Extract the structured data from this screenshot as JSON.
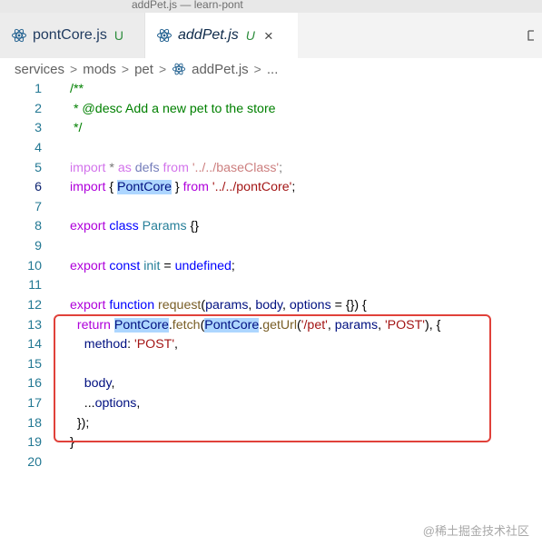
{
  "window": {
    "title": "addPet.js — learn-pont"
  },
  "tabs": [
    {
      "label": "pontCore.js",
      "status": "U",
      "active": false
    },
    {
      "label": "addPet.js",
      "status": "U",
      "active": true,
      "close": "×"
    }
  ],
  "icons": {
    "file_icon": "react-atom-icon",
    "split_editor": "split-editor-icon",
    "tab_close": "close-icon"
  },
  "breadcrumb": {
    "segments": [
      "services",
      "mods",
      "pet",
      "addPet.js",
      "..."
    ],
    "separator": ">"
  },
  "editor": {
    "active_line": 6,
    "lines": [
      {
        "n": "1",
        "tokens": [
          {
            "t": "/**",
            "c": "comment"
          }
        ]
      },
      {
        "n": "2",
        "tokens": [
          {
            "t": " * @desc Add a new pet to the store",
            "c": "comment"
          }
        ]
      },
      {
        "n": "3",
        "tokens": [
          {
            "t": " */",
            "c": "comment"
          }
        ]
      },
      {
        "n": "4",
        "tokens": []
      },
      {
        "n": "5",
        "tokens": [
          {
            "t": "import",
            "c": "kw faded"
          },
          {
            "t": " * ",
            "c": "plain faded"
          },
          {
            "t": "as",
            "c": "kw faded"
          },
          {
            "t": " defs ",
            "c": "var faded"
          },
          {
            "t": "from",
            "c": "kw faded"
          },
          {
            "t": " '../../baseClass'",
            "c": "str faded"
          },
          {
            "t": ";",
            "c": "plain faded"
          }
        ]
      },
      {
        "n": "6",
        "tokens": [
          {
            "t": "import",
            "c": "kw"
          },
          {
            "t": " { ",
            "c": "plain"
          },
          {
            "t": "PontCore",
            "c": "var hl"
          },
          {
            "t": " } ",
            "c": "plain"
          },
          {
            "t": "from",
            "c": "kw"
          },
          {
            "t": " '../../pontCore'",
            "c": "str"
          },
          {
            "t": ";",
            "c": "plain"
          }
        ]
      },
      {
        "n": "7",
        "tokens": []
      },
      {
        "n": "8",
        "tokens": [
          {
            "t": "export",
            "c": "kw"
          },
          {
            "t": " ",
            "c": "plain"
          },
          {
            "t": "class",
            "c": "kw2"
          },
          {
            "t": " ",
            "c": "plain"
          },
          {
            "t": "Params",
            "c": "type"
          },
          {
            "t": " {}",
            "c": "plain"
          }
        ]
      },
      {
        "n": "9",
        "tokens": []
      },
      {
        "n": "10",
        "tokens": [
          {
            "t": "export",
            "c": "kw"
          },
          {
            "t": " ",
            "c": "plain"
          },
          {
            "t": "const",
            "c": "kw2"
          },
          {
            "t": " ",
            "c": "plain"
          },
          {
            "t": "init",
            "c": "type"
          },
          {
            "t": " = ",
            "c": "plain"
          },
          {
            "t": "undefined",
            "c": "kw2"
          },
          {
            "t": ";",
            "c": "plain"
          }
        ]
      },
      {
        "n": "11",
        "tokens": []
      },
      {
        "n": "12",
        "tokens": [
          {
            "t": "export",
            "c": "kw"
          },
          {
            "t": " ",
            "c": "plain"
          },
          {
            "t": "function",
            "c": "kw2"
          },
          {
            "t": " ",
            "c": "plain"
          },
          {
            "t": "request",
            "c": "func"
          },
          {
            "t": "(",
            "c": "plain"
          },
          {
            "t": "params",
            "c": "var"
          },
          {
            "t": ", ",
            "c": "plain"
          },
          {
            "t": "body",
            "c": "var"
          },
          {
            "t": ", ",
            "c": "plain"
          },
          {
            "t": "options",
            "c": "var"
          },
          {
            "t": " = {}) {",
            "c": "plain"
          }
        ]
      },
      {
        "n": "13",
        "tokens": [
          {
            "t": "  ",
            "c": "plain"
          },
          {
            "t": "return",
            "c": "kw"
          },
          {
            "t": " ",
            "c": "plain"
          },
          {
            "t": "PontCore",
            "c": "var hl"
          },
          {
            "t": ".",
            "c": "plain"
          },
          {
            "t": "fetch",
            "c": "func"
          },
          {
            "t": "(",
            "c": "plain"
          },
          {
            "t": "PontCore",
            "c": "var hl"
          },
          {
            "t": ".",
            "c": "plain"
          },
          {
            "t": "getUrl",
            "c": "func"
          },
          {
            "t": "(",
            "c": "plain"
          },
          {
            "t": "'/pet'",
            "c": "str"
          },
          {
            "t": ", ",
            "c": "plain"
          },
          {
            "t": "params",
            "c": "var"
          },
          {
            "t": ", ",
            "c": "plain"
          },
          {
            "t": "'POST'",
            "c": "str"
          },
          {
            "t": "), {",
            "c": "plain"
          }
        ]
      },
      {
        "n": "14",
        "tokens": [
          {
            "t": "    ",
            "c": "plain"
          },
          {
            "t": "method",
            "c": "var"
          },
          {
            "t": ": ",
            "c": "plain"
          },
          {
            "t": "'POST'",
            "c": "str"
          },
          {
            "t": ",",
            "c": "plain"
          }
        ]
      },
      {
        "n": "15",
        "tokens": []
      },
      {
        "n": "16",
        "tokens": [
          {
            "t": "    ",
            "c": "plain"
          },
          {
            "t": "body",
            "c": "var"
          },
          {
            "t": ",",
            "c": "plain"
          }
        ]
      },
      {
        "n": "17",
        "tokens": [
          {
            "t": "    ...",
            "c": "plain"
          },
          {
            "t": "options",
            "c": "var"
          },
          {
            "t": ",",
            "c": "plain"
          }
        ]
      },
      {
        "n": "18",
        "tokens": [
          {
            "t": "  });",
            "c": "plain"
          }
        ]
      },
      {
        "n": "19",
        "tokens": [
          {
            "t": "}",
            "c": "plain"
          }
        ]
      },
      {
        "n": "20",
        "tokens": []
      }
    ]
  },
  "annotation": {
    "color": "#e0413a",
    "covers_lines": "13-18"
  },
  "watermark": "@稀土掘金技术社区",
  "colors": {
    "comment": "#008000",
    "keyword": "#af00db",
    "keyword2": "#0000ff",
    "function": "#795e26",
    "string": "#a31515",
    "type": "#267f99",
    "variable": "#001080",
    "highlight": "#add6ff"
  }
}
